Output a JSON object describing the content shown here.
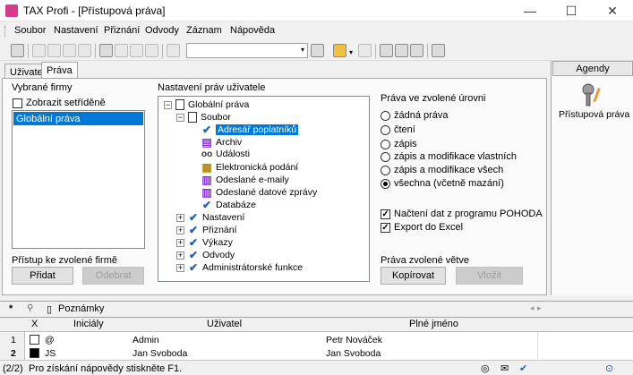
{
  "window": {
    "title": "TAX Profi - [Přístupová práva]",
    "minimize": "—",
    "maximize": "☐",
    "close": "✕"
  },
  "menu": [
    "Soubor",
    "Nastavení",
    "Přiznání",
    "Odvody",
    "Záznam",
    "Nápověda"
  ],
  "tabs": [
    "Uživatel",
    "Práva"
  ],
  "firms": {
    "heading": "Vybrané firmy",
    "sort_label": "Zobrazit setříděně",
    "items": [
      "Globální práva"
    ],
    "access_label": "Přístup ke zvolené firmě",
    "add_button": "Přidat",
    "remove_button": "Odebrat"
  },
  "rights_tree": {
    "heading": "Nastavení práv uživatele",
    "root": "Globální práva",
    "soubor": "Soubor",
    "soubor_children": [
      "Adresář poplatníků",
      "Archiv",
      "Události",
      "Elektronická podání",
      "Odeslané e-maily",
      "Odeslané datové zprávy",
      "Databáze"
    ],
    "groups": [
      "Nastavení",
      "Přiznání",
      "Výkazy",
      "Odvody",
      "Administrátorské funkce"
    ]
  },
  "level": {
    "heading": "Práva ve zvolené úrovni",
    "options": [
      "žádná práva",
      "čtení",
      "zápis",
      "zápis a modifikace vlastních",
      "zápis a modifikace všech",
      "všechna (včetně mazání)"
    ],
    "selected_index": 5
  },
  "extras": {
    "pohoda": "Načtení dat z programu POHODA",
    "excel": "Export do Excel"
  },
  "branch": {
    "heading": "Práva zvolené větve",
    "copy_button": "Kopírovat",
    "paste_button": "Vložit"
  },
  "agenda": {
    "header": "Agendy",
    "item": "Přístupová práva"
  },
  "bottom_tabs": {
    "star": "*",
    "notes": "Poznámky"
  },
  "grid": {
    "columns": [
      "X",
      "Iniciály",
      "Uživatel",
      "Plné jméno"
    ],
    "rows": [
      {
        "num": "1",
        "initials": "@",
        "user": "Admin",
        "fullname": "Petr Nováček"
      },
      {
        "num": "2",
        "initials": "JS",
        "user": "Jan Svoboda",
        "fullname": "Jan Svoboda"
      }
    ]
  },
  "status": {
    "count": "(2/2)",
    "help": "Pro získání nápovědy stiskněte F1."
  }
}
